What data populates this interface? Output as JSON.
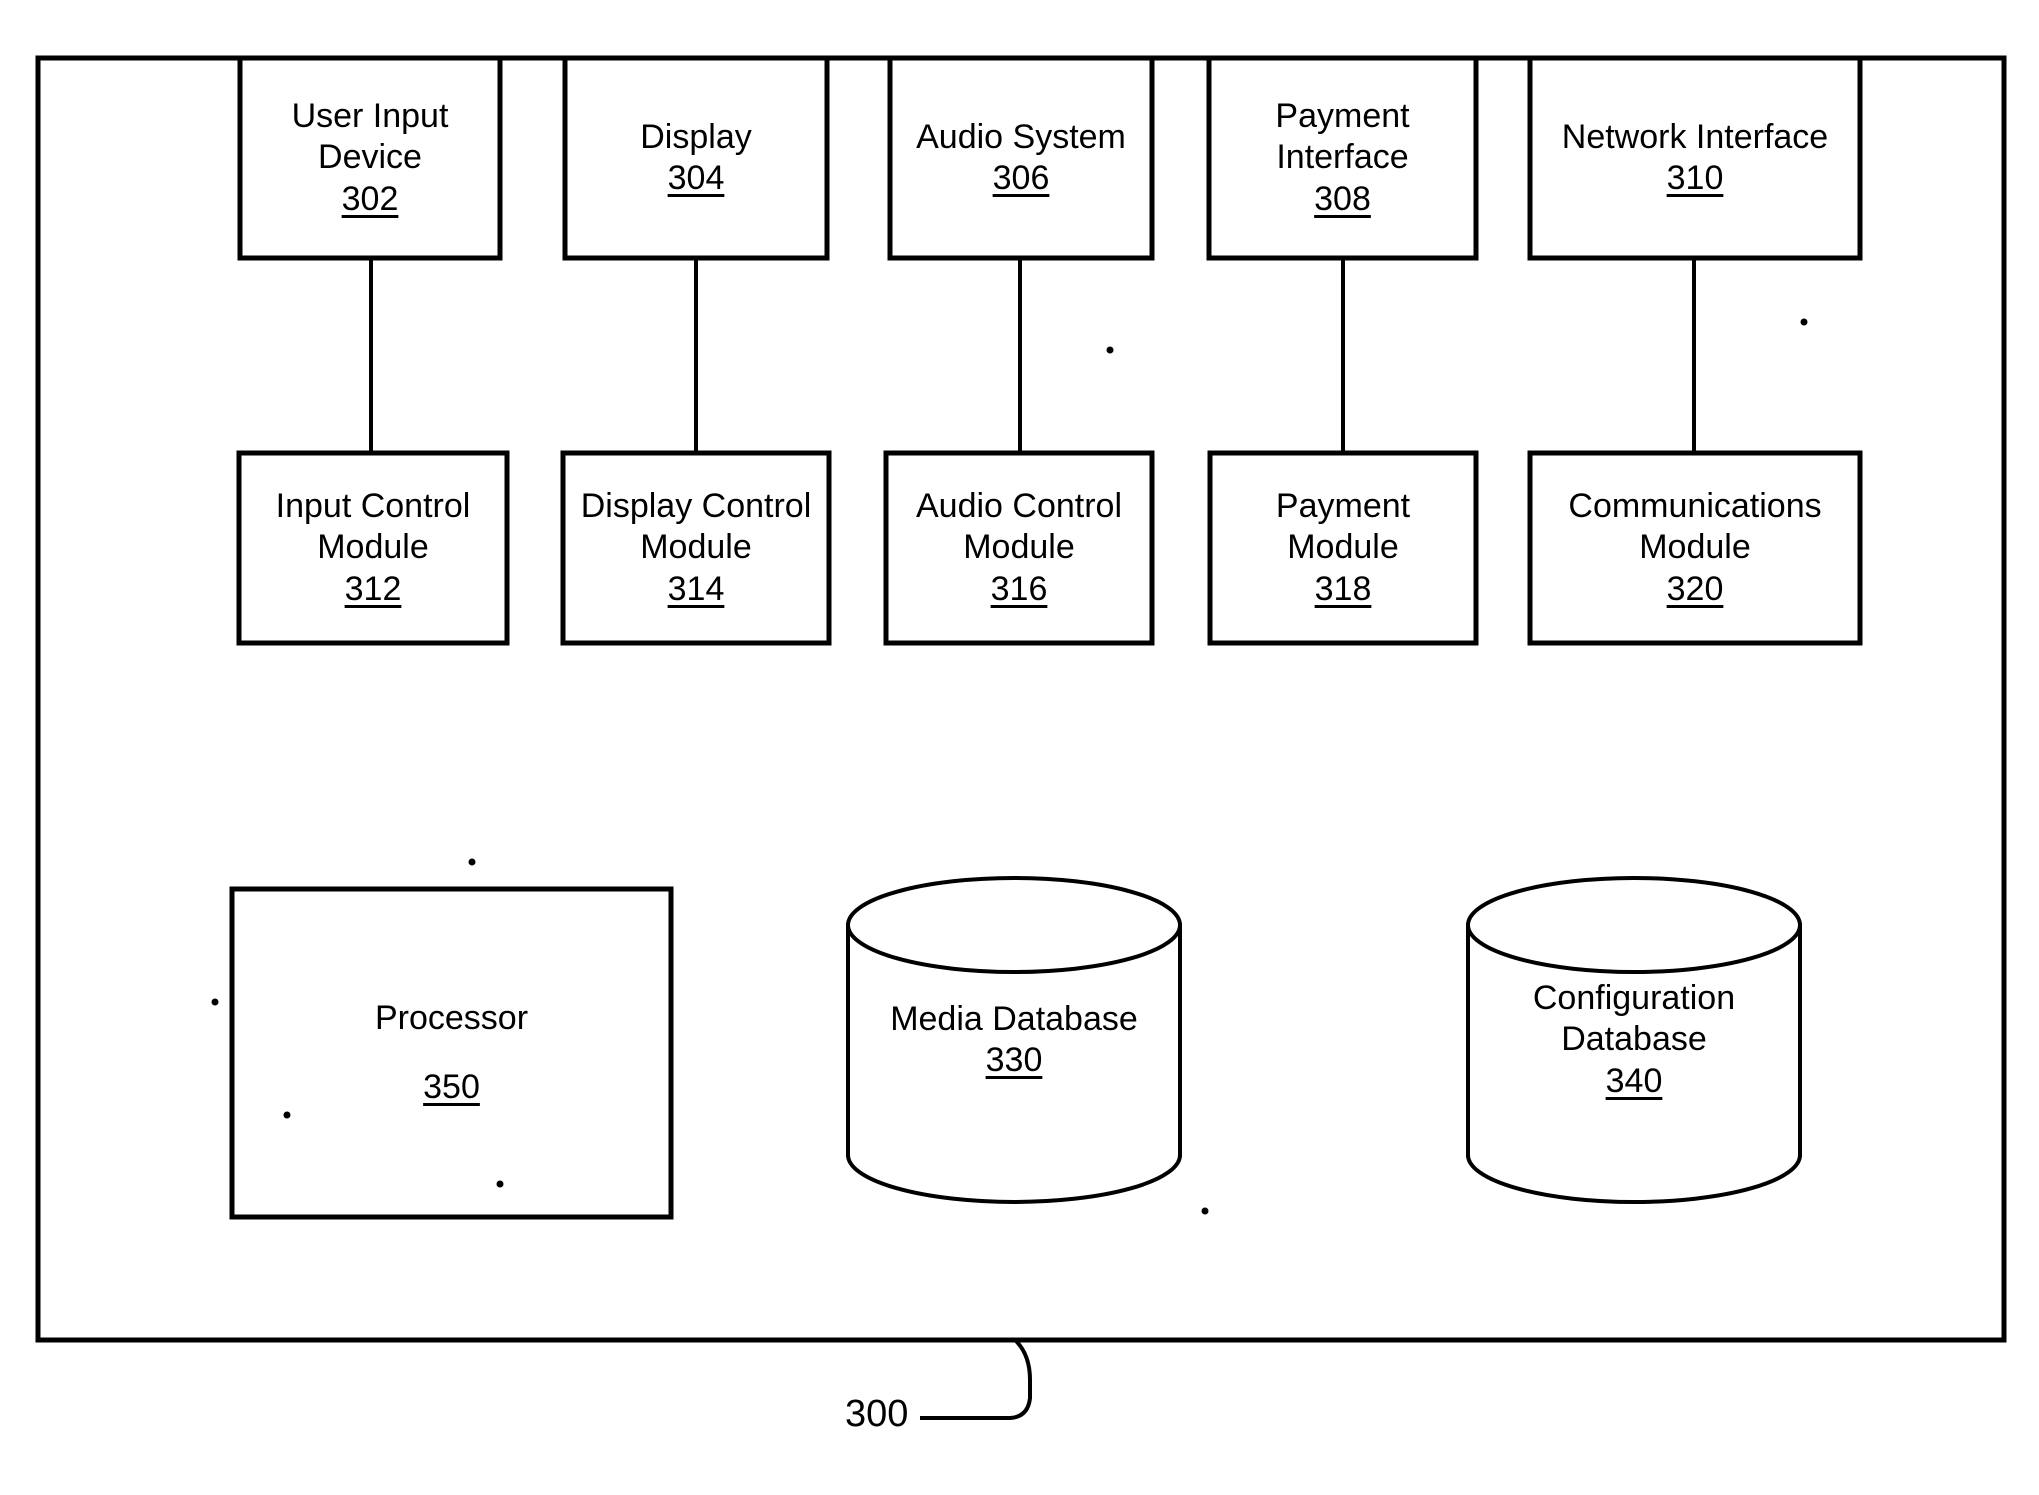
{
  "figure": {
    "reference_numeral": "300",
    "description": "System block diagram"
  },
  "nodes": {
    "top_row": [
      {
        "id": "user-input-device",
        "lines": [
          "User Input",
          "Device"
        ],
        "ref": "302"
      },
      {
        "id": "display",
        "lines": [
          "Display"
        ],
        "ref": "304"
      },
      {
        "id": "audio-system",
        "lines": [
          "Audio System"
        ],
        "ref": "306"
      },
      {
        "id": "payment-interface",
        "lines": [
          "Payment",
          "Interface"
        ],
        "ref": "308"
      },
      {
        "id": "network-interface",
        "lines": [
          "Network Interface"
        ],
        "ref": "310"
      }
    ],
    "module_row": [
      {
        "id": "input-control-module",
        "lines": [
          "Input Control",
          "Module"
        ],
        "ref": "312"
      },
      {
        "id": "display-control-module",
        "lines": [
          "Display Control",
          "Module"
        ],
        "ref": "314"
      },
      {
        "id": "audio-control-module",
        "lines": [
          "Audio Control",
          "Module"
        ],
        "ref": "316"
      },
      {
        "id": "payment-module",
        "lines": [
          "Payment",
          "Module"
        ],
        "ref": "318"
      },
      {
        "id": "communications-module",
        "lines": [
          "Communications",
          "Module"
        ],
        "ref": "320"
      }
    ],
    "bottom_row": [
      {
        "id": "processor",
        "lines": [
          "Processor"
        ],
        "ref": "350",
        "shape": "rectangle"
      },
      {
        "id": "media-database",
        "lines": [
          "Media Database"
        ],
        "ref": "330",
        "shape": "cylinder"
      },
      {
        "id": "configuration-database",
        "lines": [
          "Configuration",
          "Database"
        ],
        "ref": "340",
        "shape": "cylinder"
      }
    ]
  },
  "labels": {
    "user_input_device_l1": "User Input",
    "user_input_device_l2": "Device",
    "user_input_device_ref": "302",
    "display_l1": "Display",
    "display_ref": "304",
    "audio_system_l1": "Audio System",
    "audio_system_ref": "306",
    "payment_interface_l1": "Payment",
    "payment_interface_l2": "Interface",
    "payment_interface_ref": "308",
    "network_interface_l1": "Network Interface",
    "network_interface_ref": "310",
    "input_control_l1": "Input Control",
    "input_control_l2": "Module",
    "input_control_ref": "312",
    "display_control_l1": "Display Control",
    "display_control_l2": "Module",
    "display_control_ref": "314",
    "audio_control_l1": "Audio Control",
    "audio_control_l2": "Module",
    "audio_control_ref": "316",
    "payment_module_l1": "Payment",
    "payment_module_l2": "Module",
    "payment_module_ref": "318",
    "communications_l1": "Communications",
    "communications_l2": "Module",
    "communications_ref": "320",
    "processor_l1": "Processor",
    "processor_ref": "350",
    "media_database_l1": "Media Database",
    "media_database_ref": "330",
    "configuration_database_l1": "Configuration",
    "configuration_database_l2": "Database",
    "configuration_database_ref": "340",
    "figure_ref": "300"
  },
  "colors": {
    "stroke": "#000000",
    "background": "#ffffff"
  }
}
